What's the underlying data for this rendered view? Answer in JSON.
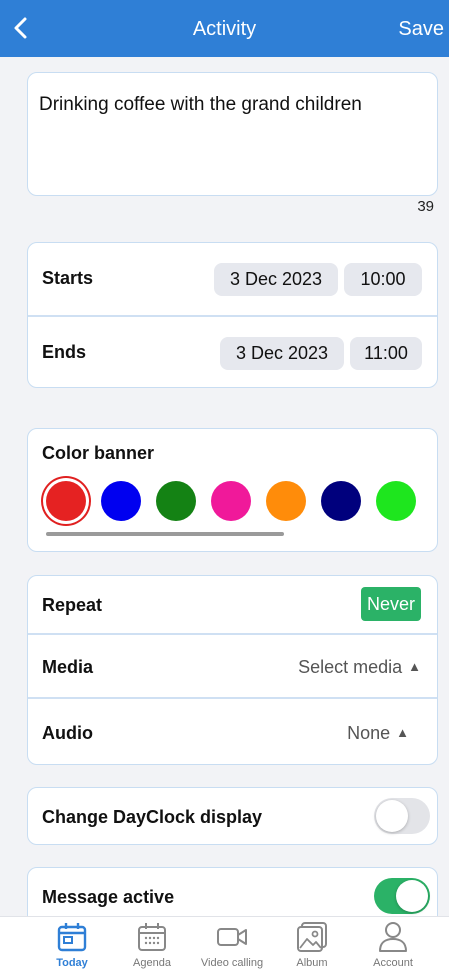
{
  "header": {
    "title": "Activity",
    "save_label": "Save",
    "back_icon": "chevron-left-icon"
  },
  "description": {
    "text": "Drinking coffee with the grand children",
    "char_count": "39"
  },
  "schedule": {
    "starts": {
      "label": "Starts",
      "date": "3 Dec 2023",
      "time": "10:00"
    },
    "ends": {
      "label": "Ends",
      "date": "3 Dec 2023",
      "time": "11:00"
    }
  },
  "color_banner": {
    "label": "Color banner",
    "selected": "#e52222",
    "colors": [
      "#e52222",
      "#0000f0",
      "#148214",
      "#f0199a",
      "#ff8c0a",
      "#00007d",
      "#1ee61e"
    ]
  },
  "options": {
    "repeat": {
      "label": "Repeat",
      "value": "Never"
    },
    "media": {
      "label": "Media",
      "value": "Select media"
    },
    "audio": {
      "label": "Audio",
      "value": "None"
    }
  },
  "dayclock": {
    "label": "Change DayClock display",
    "on": false
  },
  "message": {
    "label": "Message active",
    "on": true
  },
  "tabs": [
    {
      "label": "Today",
      "icon": "calendar-today-icon",
      "active": true
    },
    {
      "label": "Agenda",
      "icon": "calendar-grid-icon",
      "active": false
    },
    {
      "label": "Video calling",
      "icon": "video-camera-icon",
      "active": false
    },
    {
      "label": "Album",
      "icon": "photo-album-icon",
      "active": false
    },
    {
      "label": "Account",
      "icon": "person-icon",
      "active": false
    }
  ],
  "colors": {
    "brand_blue": "#2f7fd6",
    "success_green": "#2bb267"
  }
}
